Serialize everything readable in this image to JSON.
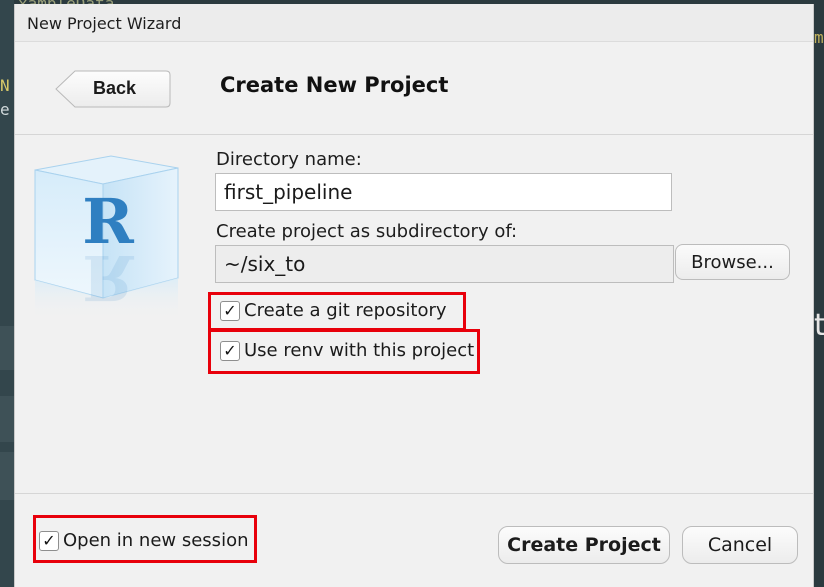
{
  "background": {
    "fragments": [
      "xampleData",
      "m",
      "N",
      "e",
      "t"
    ]
  },
  "dialog": {
    "title": "New Project Wizard",
    "back_label": "Back",
    "header_title": "Create New Project",
    "directory_label": "Directory name:",
    "directory_value": "first_pipeline",
    "parent_label": "Create project as subdirectory of:",
    "parent_value": "~/six_to",
    "browse_label": "Browse...",
    "options": {
      "git": {
        "label": "Create a git repository",
        "checked": true
      },
      "renv": {
        "label": "Use renv with this project",
        "checked": true
      },
      "new_session": {
        "label": "Open in new session",
        "checked": true
      }
    },
    "checkmark_glyph": "✓",
    "create_label": "Create Project",
    "cancel_label": "Cancel",
    "logo_letter": "R"
  },
  "colors": {
    "highlight": "#e8000b",
    "r_logo": "#2f7fc1"
  }
}
